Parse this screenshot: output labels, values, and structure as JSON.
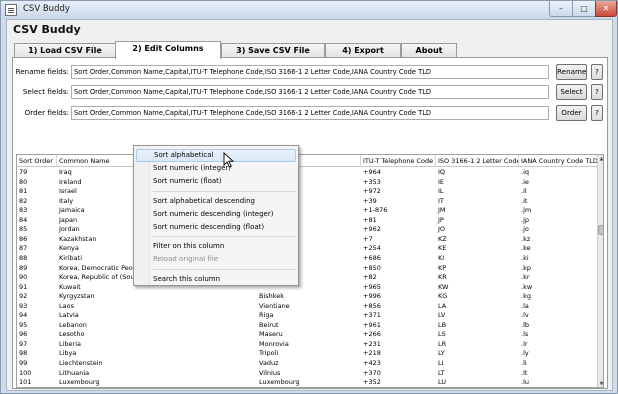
{
  "window": {
    "title": "CSV Buddy",
    "min_glyph": "–",
    "max_glyph": "□",
    "close_glyph": "✕"
  },
  "app_heading": "CSV Buddy",
  "tabs": [
    "1) Load CSV File",
    "2) Edit Columns",
    "3) Save CSV File",
    "4) Export",
    "About"
  ],
  "active_tab": "2) Edit Columns",
  "fields": {
    "rename": {
      "label": "Rename fields:",
      "value": "Sort Order,Common Name,Capital,ITU-T Telephone Code,ISO 3166-1 2 Letter Code,IANA Country Code TLD",
      "button": "Rename",
      "help": "?"
    },
    "select": {
      "label": "Select fields:",
      "value": "Sort Order,Common Name,Capital,ITU-T Telephone Code,ISO 3166-1 2 Letter Code,IANA Country Code TLD",
      "button": "Select",
      "help": "?"
    },
    "order": {
      "label": "Order fields:",
      "value": "Sort Order,Common Name,Capital,ITU-T Telephone Code,ISO 3166-1 2 Letter Code,IANA Country Code TLD",
      "button": "Order",
      "help": "?"
    }
  },
  "table": {
    "columns": [
      "Sort Order",
      "Common Name",
      "Capital",
      "ITU-T Telephone Code",
      "ISO 3166-1 2 Letter Code",
      "IANA Country Code TLD"
    ],
    "rows": [
      [
        "79",
        "Iraq",
        "",
        "+964",
        "IQ",
        ".iq"
      ],
      [
        "80",
        "Ireland",
        "",
        "+353",
        "IE",
        ".ie"
      ],
      [
        "81",
        "Israel",
        "",
        "+972",
        "IL",
        ".il"
      ],
      [
        "82",
        "Italy",
        "",
        "+39",
        "IT",
        ".it"
      ],
      [
        "83",
        "Jamaica",
        "",
        "+1-876",
        "JM",
        ".jm"
      ],
      [
        "84",
        "Japan",
        "",
        "+81",
        "JP",
        ".jp"
      ],
      [
        "85",
        "Jordan",
        "",
        "+962",
        "JO",
        ".jo"
      ],
      [
        "86",
        "Kazakhstan",
        "",
        "+7",
        "KZ",
        ".kz"
      ],
      [
        "87",
        "Kenya",
        "",
        "+254",
        "KE",
        ".ke"
      ],
      [
        "88",
        "Kiribati",
        "",
        "+686",
        "KI",
        ".ki"
      ],
      [
        "89",
        "Korea, Democratic People'",
        "",
        "+850",
        "KP",
        ".kp"
      ],
      [
        "90",
        "Korea, Republic of  (South",
        "",
        "+82",
        "KR",
        ".kr"
      ],
      [
        "91",
        "Kuwait",
        "",
        "+965",
        "KW",
        ".kw"
      ],
      [
        "92",
        "Kyrgyzstan",
        "Bishkek",
        "+996",
        "KG",
        ".kg"
      ],
      [
        "93",
        "Laos",
        "Vientiane",
        "+856",
        "LA",
        ".la"
      ],
      [
        "94",
        "Latvia",
        "Riga",
        "+371",
        "LV",
        ".lv"
      ],
      [
        "95",
        "Lebanon",
        "Beirut",
        "+961",
        "LB",
        ".lb"
      ],
      [
        "96",
        "Lesotho",
        "Maseru",
        "+266",
        "LS",
        ".ls"
      ],
      [
        "97",
        "Liberia",
        "Monrovia",
        "+231",
        "LR",
        ".lr"
      ],
      [
        "98",
        "Libya",
        "Tripoli",
        "+218",
        "LY",
        ".ly"
      ],
      [
        "99",
        "Liechtenstein",
        "Vaduz",
        "+423",
        "LI",
        ".li"
      ],
      [
        "100",
        "Lithuania",
        "Vilnius",
        "+370",
        "LT",
        ".lt"
      ],
      [
        "101",
        "Luxembourg",
        "Luxembourg",
        "+352",
        "LU",
        ".lu"
      ]
    ]
  },
  "context_menu": {
    "items": [
      {
        "label": "Sort alphabetical",
        "highlighted": true,
        "disabled": false
      },
      {
        "label": "Sort numeric (integer)",
        "highlighted": false,
        "disabled": false
      },
      {
        "label": "Sort numeric (float)",
        "highlighted": false,
        "disabled": false
      },
      {
        "label": "Sort alphabetical descending",
        "highlighted": false,
        "disabled": false
      },
      {
        "label": "Sort numeric descending (integer)",
        "highlighted": false,
        "disabled": false
      },
      {
        "label": "Sort numeric descending (float)",
        "highlighted": false,
        "disabled": false
      },
      {
        "label": "Filter on this column",
        "highlighted": false,
        "disabled": false
      },
      {
        "label": "Reload original file",
        "highlighted": false,
        "disabled": true
      },
      {
        "label": "Search this column",
        "highlighted": false,
        "disabled": false
      }
    ],
    "separators_after": [
      2,
      5,
      7
    ]
  },
  "scrollbar": {
    "position_fraction": 0.3
  },
  "colors": {
    "highlight_border": "#a8c8ec",
    "close_button": "#c8493a",
    "titlebar": "#c9d7e8"
  }
}
